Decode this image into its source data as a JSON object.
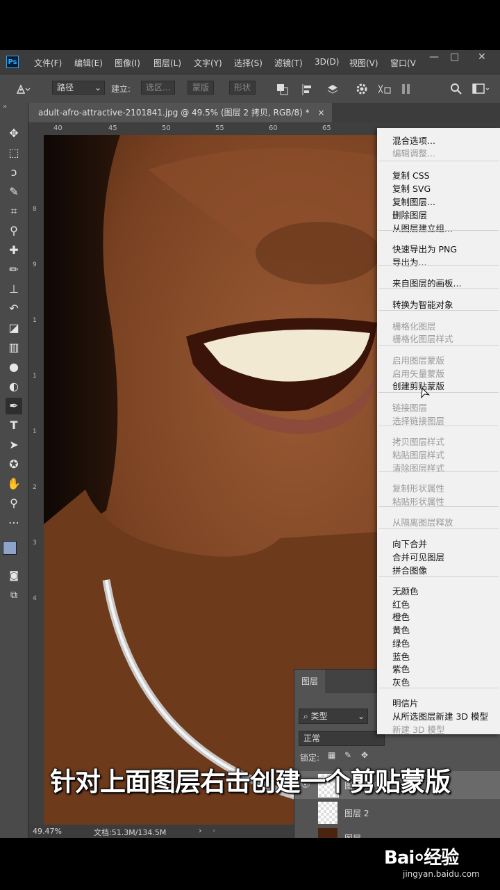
{
  "app": {
    "logo": "Ps"
  },
  "menubar": {
    "items": [
      "文件(F)",
      "编辑(E)",
      "图像(I)",
      "图层(L)",
      "文字(Y)",
      "选择(S)",
      "滤镜(T)",
      "3D(D)",
      "视图(V)",
      "窗口(V"
    ],
    "window_buttons": [
      "—",
      "□",
      "✕"
    ]
  },
  "options": {
    "mode": "路径",
    "build_label": "建立:",
    "selection_btn": "选区...",
    "mask_btn": "蒙版",
    "shape_btn": "形状"
  },
  "document": {
    "tab_title": "adult-afro-attractive-2101841.jpg @ 49.5% (图层 2 拷贝, RGB/8) *",
    "close": "×"
  },
  "ruler": {
    "top_ticks": [
      "40",
      "45",
      "50",
      "55",
      "60",
      "65"
    ],
    "left_ticks": [
      "8",
      "9",
      "1",
      "1",
      "1",
      "2",
      "3",
      "4"
    ]
  },
  "status": {
    "zoom": "49.47%",
    "doc_size": "文档:51.3M/134.5M"
  },
  "context_menu": {
    "groups": [
      [
        {
          "label": "混合选项...",
          "enabled": true
        },
        {
          "label": "编辑调整...",
          "enabled": false
        }
      ],
      [
        {
          "label": "复制 CSS",
          "enabled": true
        },
        {
          "label": "复制 SVG",
          "enabled": true
        },
        {
          "label": "复制图层...",
          "enabled": true
        },
        {
          "label": "删除图层",
          "enabled": true
        },
        {
          "label": "从图层建立组...",
          "enabled": true
        }
      ],
      [
        {
          "label": "快速导出为 PNG",
          "enabled": true
        },
        {
          "label": "导出为...",
          "enabled": true
        }
      ],
      [
        {
          "label": "来自图层的画板...",
          "enabled": true
        }
      ],
      [
        {
          "label": "转换为智能对象",
          "enabled": true
        }
      ],
      [
        {
          "label": "栅格化图层",
          "enabled": false
        },
        {
          "label": "栅格化图层样式",
          "enabled": false
        }
      ],
      [
        {
          "label": "启用图层蒙版",
          "enabled": false
        },
        {
          "label": "启用矢量蒙版",
          "enabled": false
        },
        {
          "label": "创建剪贴蒙版",
          "enabled": true
        }
      ],
      [
        {
          "label": "链接图层",
          "enabled": false
        },
        {
          "label": "选择链接图层",
          "enabled": false
        }
      ],
      [
        {
          "label": "拷贝图层样式",
          "enabled": false
        },
        {
          "label": "粘贴图层样式",
          "enabled": false
        },
        {
          "label": "清除图层样式",
          "enabled": false
        }
      ],
      [
        {
          "label": "复制形状属性",
          "enabled": false
        },
        {
          "label": "粘贴形状属性",
          "enabled": false
        }
      ],
      [
        {
          "label": "从隔离图层释放",
          "enabled": false
        }
      ],
      [
        {
          "label": "向下合并",
          "enabled": true
        },
        {
          "label": "合并可见图层",
          "enabled": true
        },
        {
          "label": "拼合图像",
          "enabled": true
        }
      ],
      [
        {
          "label": "无颜色",
          "enabled": true
        },
        {
          "label": "红色",
          "enabled": true
        },
        {
          "label": "橙色",
          "enabled": true
        },
        {
          "label": "黄色",
          "enabled": true
        },
        {
          "label": "绿色",
          "enabled": true
        },
        {
          "label": "蓝色",
          "enabled": true
        },
        {
          "label": "紫色",
          "enabled": true
        },
        {
          "label": "灰色",
          "enabled": true
        }
      ],
      [
        {
          "label": "明信片",
          "enabled": true
        },
        {
          "label": "从所选图层新建 3D 模型",
          "enabled": true
        },
        {
          "label": "新建 3D 模型",
          "enabled": false
        }
      ]
    ]
  },
  "layers_panel": {
    "tab": "图层",
    "filter": "类型",
    "blend_mode": "正常",
    "lock_label": "锁定:",
    "layers": [
      {
        "name": "图层 2 拷贝",
        "selected": true
      },
      {
        "name": "图层 2",
        "selected": false
      },
      {
        "name": "图层",
        "selected": false
      }
    ]
  },
  "caption": "针对上面图层右击创建一个剪贴蒙版",
  "watermark": {
    "brand": "Bai⸰经验",
    "url": "jingyan.baidu.com"
  },
  "colors": {
    "ps_accent": "#31a8ff",
    "skin": "#6a3a1e",
    "menu_bg": "#f1f1f1"
  }
}
